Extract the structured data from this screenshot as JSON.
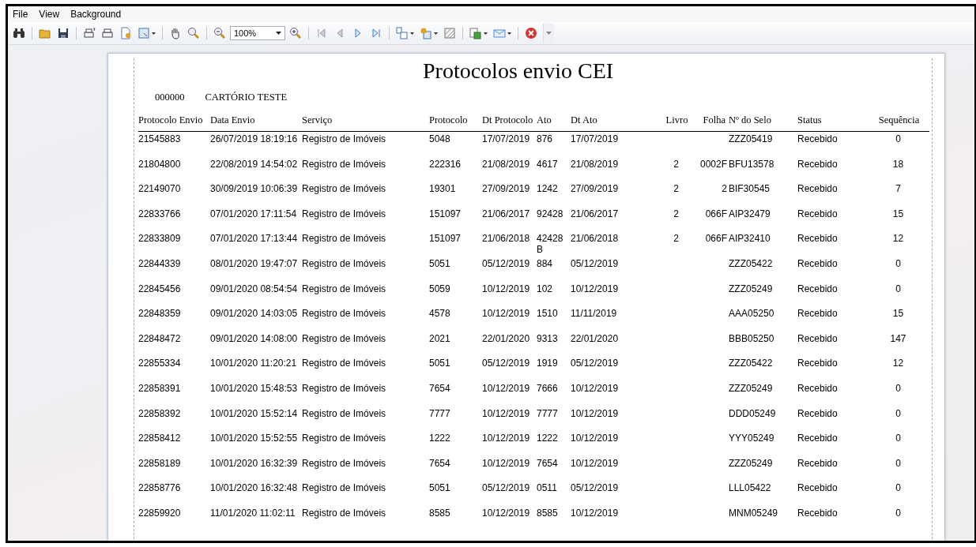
{
  "menu": [
    "File",
    "View",
    "Background"
  ],
  "toolbar": {
    "zoom": "100%"
  },
  "report": {
    "title": "Protocolos envio CEI",
    "code": "000000",
    "office": "CARTÓRIO TESTE",
    "columns": [
      "Protocolo Envio",
      "Data Envio",
      "Serviço",
      "Protocolo",
      "Dt Protocolo",
      "Ato",
      "Dt Ato",
      "Livro",
      "Folha",
      "Nº do Selo",
      "Status",
      "Sequência"
    ],
    "rows": [
      [
        "21545883",
        "26/07/2019 18:19:16",
        "Registro de Imóveis",
        "5048",
        "17/07/2019",
        "876",
        "17/07/2019",
        "",
        "",
        "ZZZ05419",
        "Recebido",
        "0"
      ],
      [
        "21804800",
        "22/08/2019 14:54:02",
        "Registro de Imóveis",
        "222316",
        "21/08/2019",
        "4617",
        "21/08/2019",
        "2",
        "0002F",
        "BFU13578",
        "Recebido",
        "18"
      ],
      [
        "22149070",
        "30/09/2019 10:06:39",
        "Registro de Imóveis",
        "19301",
        "27/09/2019",
        "1242",
        "27/09/2019",
        "2",
        "2",
        "BIF30545",
        "Recebido",
        "7"
      ],
      [
        "22833766",
        "07/01/2020 17:11:54",
        "Registro de Imóveis",
        "151097",
        "21/06/2017",
        "92428",
        "21/06/2017",
        "2",
        "066F",
        "AIP32479",
        "Recebido",
        "15"
      ],
      [
        "22833809",
        "07/01/2020 17:13:44",
        "Registro de Imóveis",
        "151097",
        "21/06/2018",
        "42428B",
        "21/06/2018",
        "2",
        "066F",
        "AIP32410",
        "Recebido",
        "12"
      ],
      [
        "22844339",
        "08/01/2020 19:47:07",
        "Registro de Imóveis",
        "5051",
        "05/12/2019",
        "884",
        "05/12/2019",
        "",
        "",
        "ZZZ05422",
        "Recebido",
        "0"
      ],
      [
        "22845456",
        "09/01/2020 08:54:54",
        "Registro de Imóveis",
        "5059",
        "10/12/2019",
        "102",
        "10/12/2019",
        "",
        "",
        "ZZZ05249",
        "Recebido",
        "0"
      ],
      [
        "22848359",
        "09/01/2020 14:03:05",
        "Registro de Imóveis",
        "4578",
        "10/12/2019",
        "1510",
        "11/11/2019",
        "",
        "",
        "AAA05250",
        "Recebido",
        "15"
      ],
      [
        "22848472",
        "09/01/2020 14:08:00",
        "Registro de Imóveis",
        "2021",
        "22/01/2020",
        "9313",
        "22/01/2020",
        "",
        "",
        "BBB05250",
        "Recebido",
        "147"
      ],
      [
        "22855334",
        "10/01/2020 11:20:21",
        "Registro de Imóveis",
        "5051",
        "05/12/2019",
        "1919",
        "05/12/2019",
        "",
        "",
        "ZZZ05422",
        "Recebido",
        "12"
      ],
      [
        "22858391",
        "10/01/2020 15:48:53",
        "Registro de Imóveis",
        "7654",
        "10/12/2019",
        "7666",
        "10/12/2019",
        "",
        "",
        "ZZZ05249",
        "Recebido",
        "0"
      ],
      [
        "22858392",
        "10/01/2020 15:52:14",
        "Registro de Imóveis",
        "7777",
        "10/12/2019",
        "7777",
        "10/12/2019",
        "",
        "",
        "DDD05249",
        "Recebido",
        "0"
      ],
      [
        "22858412",
        "10/01/2020 15:52:55",
        "Registro de Imóveis",
        "1222",
        "10/12/2019",
        "1222",
        "10/12/2019",
        "",
        "",
        "YYY05249",
        "Recebido",
        "0"
      ],
      [
        "22858189",
        "10/01/2020 16:32:39",
        "Registro de Imóveis",
        "7654",
        "10/12/2019",
        "7654",
        "10/12/2019",
        "",
        "",
        "ZZZ05249",
        "Recebido",
        "0"
      ],
      [
        "22858776",
        "10/01/2020 16:32:48",
        "Registro de Imóveis",
        "5051",
        "05/12/2019",
        "0511",
        "05/12/2019",
        "",
        "",
        "LLL05422",
        "Recebido",
        "0"
      ],
      [
        "22859920",
        "11/01/2020 11:02:11",
        "Registro de Imóveis",
        "8585",
        "10/12/2019",
        "8585",
        "10/12/2019",
        "",
        "",
        "MNM05249",
        "Recebido",
        "0"
      ]
    ]
  }
}
